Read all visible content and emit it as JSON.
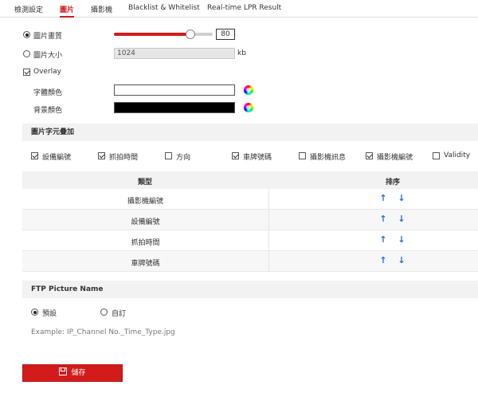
{
  "tabs": [
    {
      "label": "檢測設定",
      "active": false
    },
    {
      "label": "圖片",
      "active": true
    },
    {
      "label": "攝影機",
      "active": false
    },
    {
      "label": "Blacklist & Whitelist",
      "active": false
    },
    {
      "label": "Real-time LPR Result",
      "active": false
    }
  ],
  "quality": {
    "label": "圖片畫質",
    "selected": true,
    "value": "80",
    "slider_fraction": 0.8
  },
  "size": {
    "label": "圖片大小",
    "selected": false,
    "value": "1024",
    "unit": "kb"
  },
  "overlay": {
    "label": "Overlay",
    "checked": true
  },
  "font_color": {
    "label": "字體顏色",
    "color": "#ffffff"
  },
  "bg_color": {
    "label": "背景顏色",
    "color": "#000000"
  },
  "overlay_section": {
    "title": "圖片字元疊加"
  },
  "overlay_items": [
    {
      "label": "設備編號",
      "checked": true
    },
    {
      "label": "抓拍時間",
      "checked": true
    },
    {
      "label": "方向",
      "checked": false
    },
    {
      "label": "車牌號碼",
      "checked": true
    },
    {
      "label": "攝影機訊息",
      "checked": false
    },
    {
      "label": "攝影機編號",
      "checked": true
    },
    {
      "label": "Validity",
      "checked": false
    }
  ],
  "table": {
    "col_type": "類型",
    "col_order": "排序",
    "rows": [
      "攝影機編號",
      "設備編號",
      "抓拍時間",
      "車牌號碼"
    ],
    "up_icon": "arrow-up-icon",
    "down_icon": "arrow-down-icon"
  },
  "ftp": {
    "title": "FTP Picture Name",
    "options": [
      {
        "label": "預設",
        "selected": true
      },
      {
        "label": "自訂",
        "selected": false
      }
    ],
    "example": "Example: IP_Channel No._Time_Type.jpg"
  },
  "save": {
    "label": "儲存",
    "icon": "save-icon"
  },
  "colors": {
    "accent": "#d31b1b",
    "arrow": "#1a6fd1",
    "section_bg": "#f2f2f2"
  }
}
